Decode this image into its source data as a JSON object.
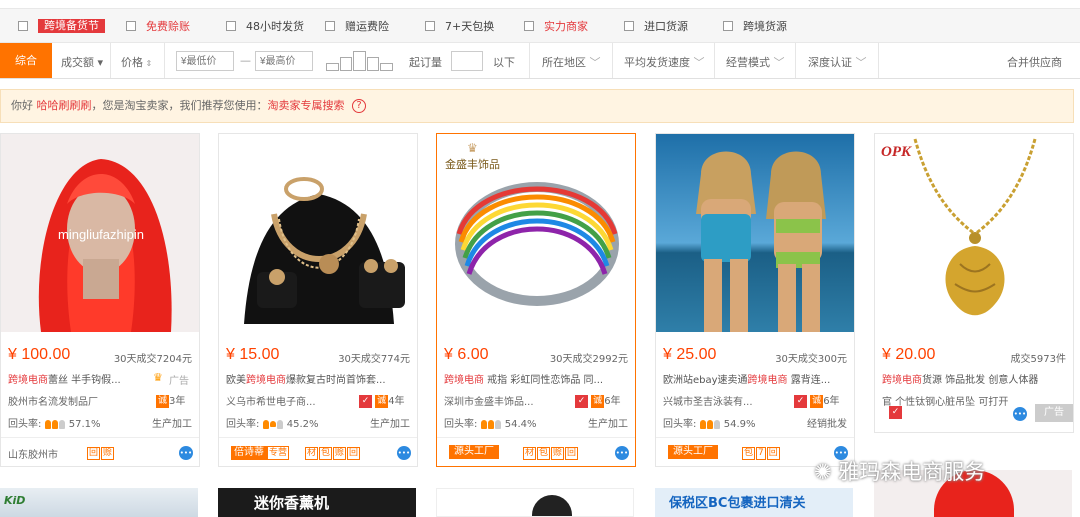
{
  "filters": {
    "items": [
      {
        "label": "跨境备货节",
        "style": "tag"
      },
      {
        "label": "免费赊账",
        "style": "red"
      },
      {
        "label": "48小时发货",
        "style": "normal"
      },
      {
        "label": "赠运费险",
        "style": "normal"
      },
      {
        "label": "7+天包换",
        "style": "normal"
      },
      {
        "label": "实力商家",
        "style": "red"
      },
      {
        "label": "进口货源",
        "style": "normal"
      },
      {
        "label": "跨境货源",
        "style": "normal"
      }
    ]
  },
  "sort": {
    "composite": "综合",
    "volume": "成交额",
    "price": "价格",
    "min_placeholder": "¥最低价",
    "dash": "—",
    "max_placeholder": "¥最高价",
    "moq": "起订量",
    "below": "以下",
    "region": "所在地区",
    "ship_speed": "平均发货速度",
    "mode": "经营模式",
    "depth": "深度认证",
    "merge": "合并供应商"
  },
  "notice": {
    "prefix": "你好",
    "user": "哈哈刷刷刷",
    "middle": "，您是淘宝卖家，我们推荐您使用：",
    "link": "淘卖家专属搜索",
    "help": "?"
  },
  "products": [
    {
      "img_text": "mingliufazhipin",
      "price": "¥ 100.00",
      "deals": "30天成交7204元",
      "title_red": "跨境电商",
      "title": "蕾丝 半手钩假...",
      "ad": "广告",
      "loc": "胶州市名流发制品厂",
      "years": "3年",
      "rate_label": "回头率:",
      "rate": "57.1%",
      "ptype": "生产加工",
      "footer_loc": "山东胶州市",
      "badges": [
        "回",
        "赊"
      ],
      "factory": ""
    },
    {
      "img_text": "",
      "price": "¥ 15.00",
      "deals": "30天成交774元",
      "title_pre": "欧美",
      "title_red": "跨境电商",
      "title": "爆款复古时尚首饰套...",
      "loc": "义乌市希世电子商...",
      "years": "4年",
      "rate_label": "回头率:",
      "rate": "45.2%",
      "ptype": "生产加工",
      "footer_tag": "倍诗蒂",
      "footer_tag2": "专营",
      "badges": [
        "材",
        "包",
        "赊",
        "回"
      ],
      "factory": ""
    },
    {
      "img_text": "金盛丰饰品",
      "price": "¥ 6.00",
      "deals": "30天成交2992元",
      "title_red": "跨境电商",
      "title": " 戒指 彩虹同性恋饰品 同...",
      "loc": "深圳市金盛丰饰品...",
      "years": "6年",
      "rate_label": "回头率:",
      "rate": "54.4%",
      "ptype": "生产加工",
      "factory": "源头工厂",
      "badges": [
        "材",
        "包",
        "赊",
        "回"
      ]
    },
    {
      "img_text": "",
      "price": "¥ 25.00",
      "deals": "30天成交300元",
      "title_pre": "欧洲站ebay速卖通",
      "title_red": "跨境电商",
      "title": " 露背连...",
      "loc": "兴城市圣吉泳装有...",
      "years": "6年",
      "rate_label": "回头率:",
      "rate": "54.9%",
      "ptype": "经销批发",
      "factory": "源头工厂",
      "badges": [
        "包",
        "7",
        "回"
      ]
    },
    {
      "img_text": "OPK",
      "price": "¥ 20.00",
      "deals": "成交5973件",
      "title_red": "跨境电商",
      "title": "货源 饰品批发 创意人体器",
      "title2": "官 个性钛钢心脏吊坠 可打开",
      "ad": "广告",
      "badges": [],
      "factory": ""
    }
  ],
  "bottom": {
    "row2_b": "迷你香薰机",
    "row2_d": "保税区BC包裹进口清关"
  },
  "watermark": "雅玛森电商服务",
  "colors": {
    "accent": "#ff7300",
    "price": "#ff4200",
    "red": "#e4393c",
    "notice_bg": "#fff4e2"
  }
}
